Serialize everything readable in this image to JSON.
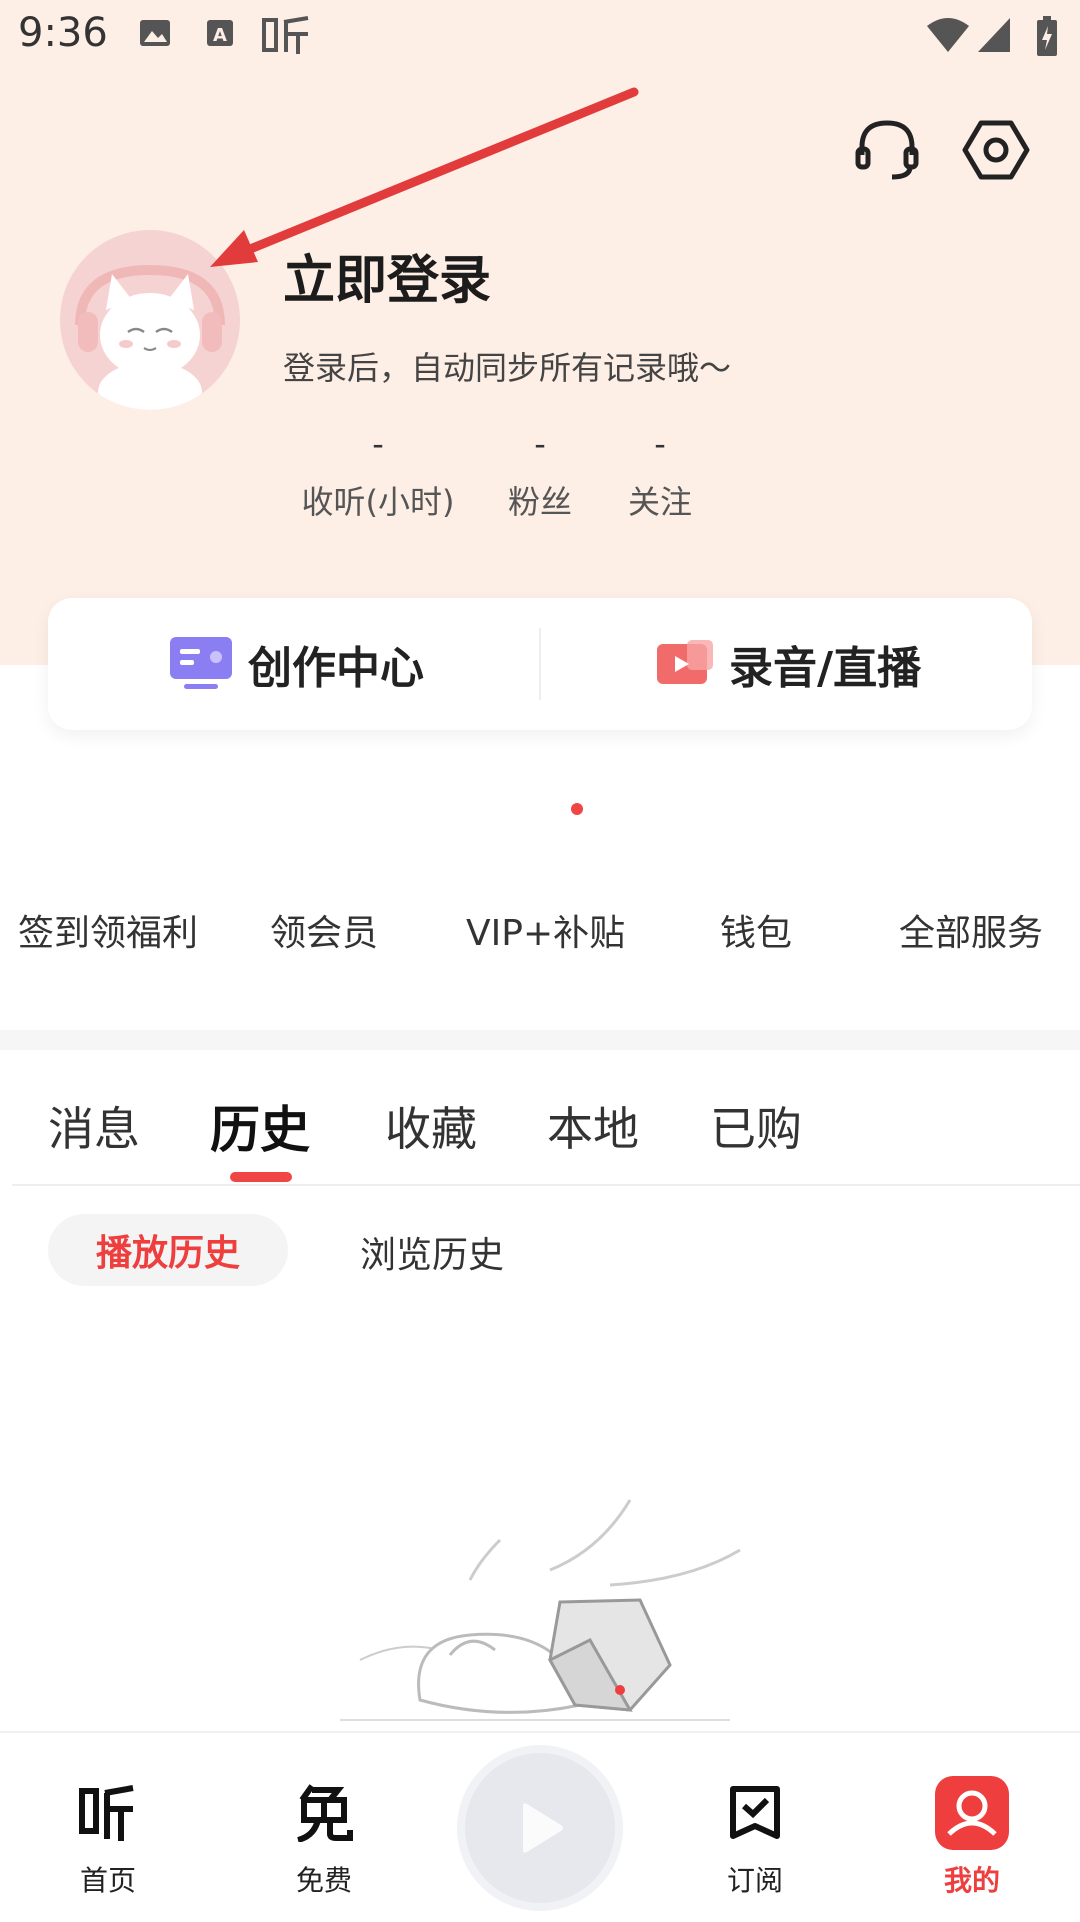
{
  "status_bar": {
    "time": "9:36",
    "icons": [
      "image-icon",
      "a-icon",
      "ting-app-icon",
      "wifi-icon",
      "signal-icon",
      "battery-icon"
    ]
  },
  "header": {
    "icons": [
      "headset-icon",
      "settings-icon"
    ]
  },
  "profile": {
    "title": "立即登录",
    "subtitle": "登录后，自动同步所有记录哦～",
    "stats": [
      {
        "value": "-",
        "label": "收听(小时)"
      },
      {
        "value": "-",
        "label": "粉丝"
      },
      {
        "value": "-",
        "label": "关注"
      }
    ]
  },
  "card": {
    "left_label": "创作中心",
    "right_label": "录音/直播"
  },
  "services": [
    "签到领福利",
    "领会员",
    "VIP+补贴",
    "钱包",
    "全部服务"
  ],
  "tabs": [
    "消息",
    "历史",
    "收藏",
    "本地",
    "已购"
  ],
  "active_tab": "历史",
  "subtabs": [
    "播放历史",
    "浏览历史"
  ],
  "bottom_nav": [
    {
      "label": "首页",
      "icon": "ting-icon"
    },
    {
      "label": "免费",
      "icon": "mian-icon"
    },
    {
      "label": "",
      "icon": "play-icon"
    },
    {
      "label": "订阅",
      "icon": "bookmark-check-icon"
    },
    {
      "label": "我的",
      "icon": "user-icon"
    }
  ],
  "colors": {
    "accent": "#ef3e3e",
    "hero_bg": "#fdeee6"
  }
}
